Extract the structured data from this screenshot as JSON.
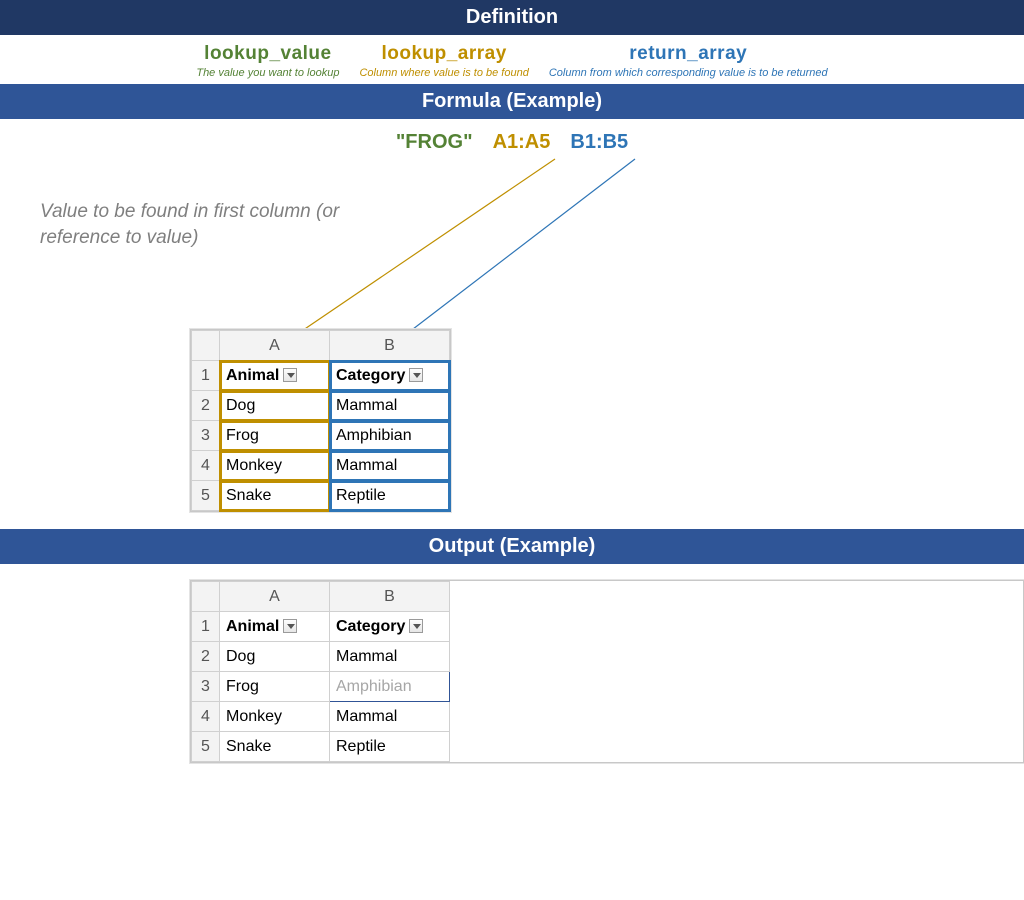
{
  "sections": {
    "definition": "Definition",
    "formula": "Formula (Example)",
    "output": "Output (Example)"
  },
  "definition": {
    "lookup_value": {
      "label": "lookup_value",
      "desc": "The value you want to lookup"
    },
    "lookup_array": {
      "label": "lookup_array",
      "desc": "Column where value is to be found"
    },
    "return_array": {
      "label": "return_array",
      "desc": "Column from which corresponding value is to be returned"
    }
  },
  "formula": {
    "arg1": "\"FROG\"",
    "arg2": "A1:A5",
    "arg3": "B1:B5"
  },
  "hint": "Value to be found in first column (or reference to value)",
  "table": {
    "headers": {
      "A": "A",
      "B": "B"
    },
    "titles": {
      "A": "Animal",
      "B": "Category"
    },
    "rows": [
      {
        "n": "1"
      },
      {
        "n": "2",
        "A": "Dog",
        "B": "Mammal"
      },
      {
        "n": "3",
        "A": "Frog",
        "B": "Amphibian"
      },
      {
        "n": "4",
        "A": "Monkey",
        "B": "Mammal"
      },
      {
        "n": "5",
        "A": "Snake",
        "B": "Reptile"
      }
    ]
  },
  "output_result": "Amphibian",
  "colors": {
    "green": "#548235",
    "gold": "#bf8f00",
    "blue": "#2e75b6"
  }
}
